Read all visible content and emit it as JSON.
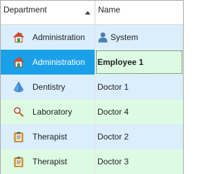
{
  "columns": {
    "department": "Department",
    "name": "Name"
  },
  "sort": {
    "column": "Department",
    "direction": "ascending"
  },
  "rows": [
    {
      "department": "Administration",
      "name": "System",
      "dept_icon": "house-icon",
      "name_icon": "user-icon",
      "bg": "#daeefc",
      "name_bg": "#daeefc",
      "selected": false
    },
    {
      "department": "Administration",
      "name": "Employee 1",
      "dept_icon": "house-icon",
      "bg": "#1aa0e8",
      "name_bg": "#ddfbe3",
      "selected": true
    },
    {
      "department": "Dentistry",
      "name": "Doctor 1",
      "dept_icon": "tooth-icon",
      "bg": "#daeefc",
      "name_bg": "#daeefc",
      "selected": false
    },
    {
      "department": "Laboratory",
      "name": "Doctor 4",
      "dept_icon": "magnifier-icon",
      "bg": "#ddfbe3",
      "name_bg": "#ddfbe3",
      "selected": false
    },
    {
      "department": "Therapist",
      "name": "Doctor 2",
      "dept_icon": "clipboard-icon",
      "bg": "#daeefc",
      "name_bg": "#daeefc",
      "selected": false
    },
    {
      "department": "Therapist",
      "name": "Doctor 3",
      "dept_icon": "clipboard-icon",
      "bg": "#ddfbe3",
      "name_bg": "#ddfbe3",
      "selected": false
    }
  ],
  "colors": {
    "blue_row": "#daeefc",
    "green_row": "#ddfbe3",
    "selection": "#1aa0e8"
  }
}
